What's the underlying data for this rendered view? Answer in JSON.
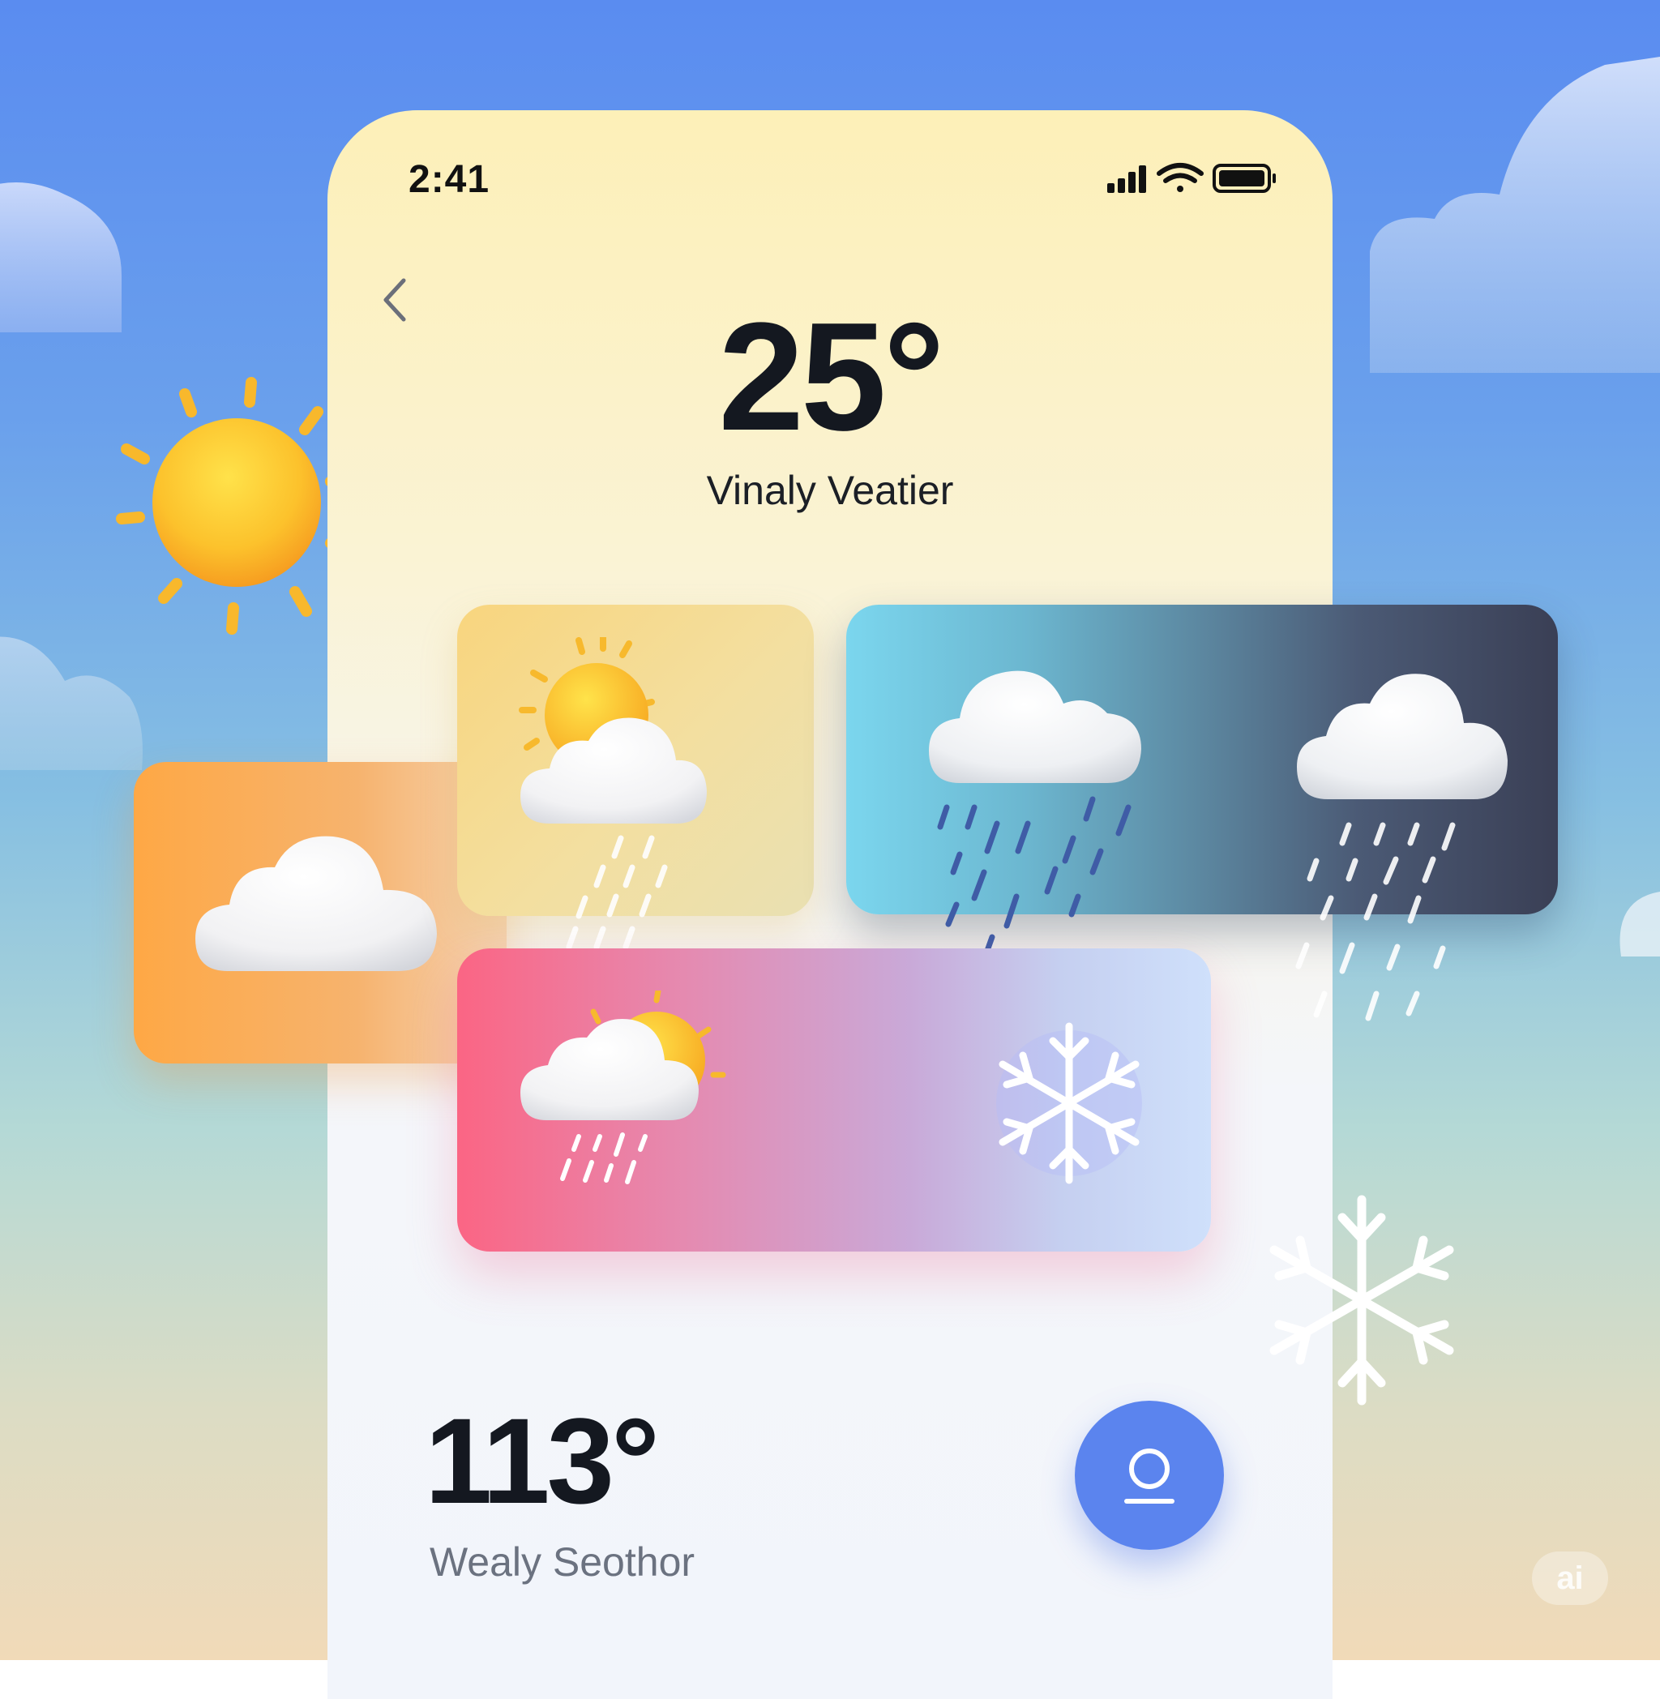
{
  "status_bar": {
    "time": "2:41"
  },
  "main": {
    "temperature": "25°",
    "location": "Vinaly Veatier"
  },
  "secondary": {
    "temperature": "113°",
    "location": "Wealy Seothor"
  },
  "watermark": "ai",
  "icons": {
    "back": "chevron-left-icon",
    "signal": "cellular-signal-icon",
    "wifi": "wifi-icon",
    "battery": "battery-icon",
    "fab": "location-pin-icon",
    "cards": [
      "cloud-icon",
      "partly-cloudy-rain-icon",
      "rain-cloud-icon",
      "rain-cloud-icon",
      "sun-cloud-rain-icon",
      "snowflake-icon"
    ]
  },
  "colors": {
    "accent": "#5b84ee",
    "text_dark": "#141820",
    "text_muted": "#6b7280"
  }
}
